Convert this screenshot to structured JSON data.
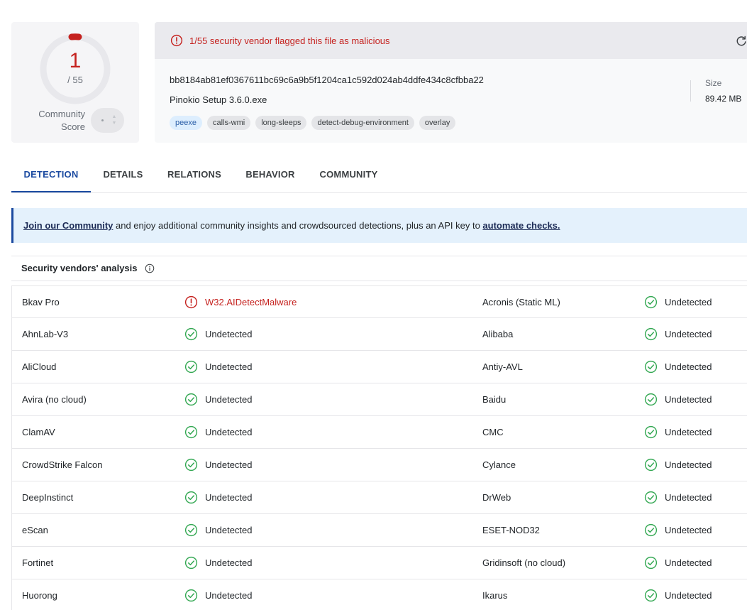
{
  "score": {
    "detections": "1",
    "total": "/ 55",
    "community_label_line1": "Community",
    "community_label_line2": "Score",
    "community_value": "?"
  },
  "file": {
    "alert": "1/55 security vendor flagged this file as malicious",
    "hash": "bb8184ab81ef0367611bc69c6a9b5f1204ca1c592d024ab4ddfe434c8cfbba22",
    "name": "Pinokio Setup 3.6.0.exe",
    "tags": [
      "peexe",
      "calls-wmi",
      "long-sleeps",
      "detect-debug-environment",
      "overlay"
    ],
    "size_label": "Size",
    "size_value": "89.42 MB"
  },
  "tabs": [
    "DETECTION",
    "DETAILS",
    "RELATIONS",
    "BEHAVIOR",
    "COMMUNITY"
  ],
  "active_tab": "DETECTION",
  "banner": {
    "link1": "Join our Community",
    "middle": " and enjoy additional community insights and crowdsourced detections, plus an API key to ",
    "link2": "automate checks."
  },
  "section": {
    "title": "Security vendors' analysis"
  },
  "vendors": [
    {
      "left_name": "Bkav Pro",
      "left_result": "W32.AIDetectMalware",
      "left_status": "malicious",
      "right_name": "Acronis (Static ML)",
      "right_result": "Undetected",
      "right_status": "clean"
    },
    {
      "left_name": "AhnLab-V3",
      "left_result": "Undetected",
      "left_status": "clean",
      "right_name": "Alibaba",
      "right_result": "Undetected",
      "right_status": "clean"
    },
    {
      "left_name": "AliCloud",
      "left_result": "Undetected",
      "left_status": "clean",
      "right_name": "Antiy-AVL",
      "right_result": "Undetected",
      "right_status": "clean"
    },
    {
      "left_name": "Avira (no cloud)",
      "left_result": "Undetected",
      "left_status": "clean",
      "right_name": "Baidu",
      "right_result": "Undetected",
      "right_status": "clean"
    },
    {
      "left_name": "ClamAV",
      "left_result": "Undetected",
      "left_status": "clean",
      "right_name": "CMC",
      "right_result": "Undetected",
      "right_status": "clean"
    },
    {
      "left_name": "CrowdStrike Falcon",
      "left_result": "Undetected",
      "left_status": "clean",
      "right_name": "Cylance",
      "right_result": "Undetected",
      "right_status": "clean"
    },
    {
      "left_name": "DeepInstinct",
      "left_result": "Undetected",
      "left_status": "clean",
      "right_name": "DrWeb",
      "right_result": "Undetected",
      "right_status": "clean"
    },
    {
      "left_name": "eScan",
      "left_result": "Undetected",
      "left_status": "clean",
      "right_name": "ESET-NOD32",
      "right_result": "Undetected",
      "right_status": "clean"
    },
    {
      "left_name": "Fortinet",
      "left_result": "Undetected",
      "left_status": "clean",
      "right_name": "Gridinsoft (no cloud)",
      "right_result": "Undetected",
      "right_status": "clean"
    },
    {
      "left_name": "Huorong",
      "left_result": "Undetected",
      "left_status": "clean",
      "right_name": "Ikarus",
      "right_result": "Undetected",
      "right_status": "clean"
    }
  ],
  "colors": {
    "malicious": "#c5221f",
    "clean": "#34a853",
    "accent": "#1b4aa0"
  },
  "icons": {
    "alert": "alert-circle-icon",
    "refresh": "refresh-icon",
    "info": "info-icon",
    "clean": "check-circle-icon",
    "malicious": "alert-circle-icon"
  }
}
